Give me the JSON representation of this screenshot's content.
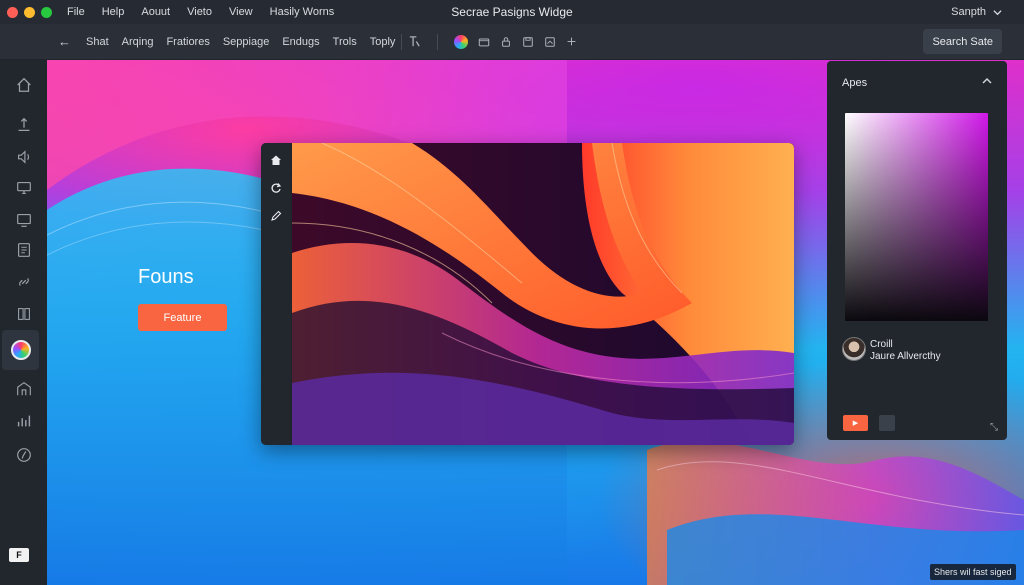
{
  "titlebar": {
    "menu": [
      "File",
      "Help",
      "Aouut",
      "Vieto",
      "View",
      "Hasily Worns"
    ],
    "window_title": "Secrae Pasigns Widge",
    "user": "Sanpth"
  },
  "toolbar": {
    "items": [
      "Shat",
      "Arqing",
      "Fratiores",
      "Seppiage",
      "Endugs",
      "Trols",
      "Toply"
    ],
    "search_label": "Search Sate"
  },
  "canvas": {
    "title": "Founs",
    "feature_label": "Feature"
  },
  "panel": {
    "title": "Apes",
    "person_line1": "Croill",
    "person_line2": "Jaure Allvercthy"
  },
  "badge": "F",
  "status": "Shers wil fast siged",
  "colors": {
    "accent": "#f86540",
    "panel_bg": "#22272e",
    "toolbar_bg": "#2b3038"
  },
  "icons": {
    "sidebar": [
      "home-icon",
      "upload-icon",
      "speaker-icon",
      "monitor-icon",
      "screen-icon",
      "document-icon",
      "link-icon",
      "grid-icon",
      "color-wheel-icon",
      "building-icon",
      "chart-icon",
      "compass-icon"
    ]
  }
}
